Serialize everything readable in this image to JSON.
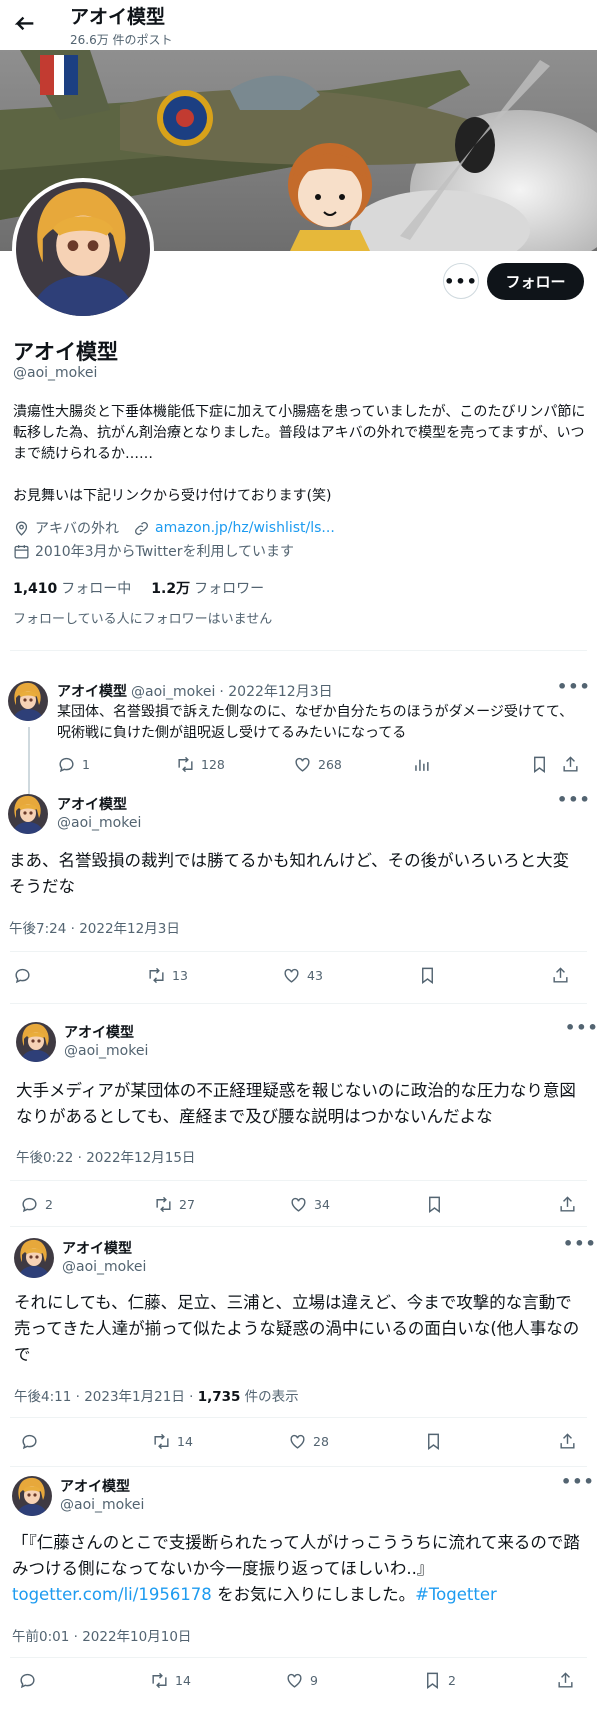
{
  "header": {
    "title": "アオイ模型",
    "post_count": "26.6万 件のポスト"
  },
  "profile": {
    "name": "アオイ模型",
    "handle": "@aoi_mokei",
    "follow_label": "フォロー",
    "more_label": "•••",
    "bio": [
      "潰瘍性大腸炎と下垂体機能低下症に加えて小腸癌を患っていましたが、このたびリンパ節に転移した為、抗がん剤治療となりました。普段はアキバの外れで模型を売ってますが、いつまで続けられるか……",
      "お見舞いは下記リンクから受け付けております(笑)"
    ],
    "location": "アキバの外れ",
    "url": "amazon.jp/hz/wishlist/ls...",
    "joined": "2010年3月からTwitterを利用しています",
    "following_count": "1,410",
    "following_label": "フォロー中",
    "followers_count": "1.2万",
    "followers_label": "フォロワー",
    "followers_note": "フォローしている人にフォロワーはいません"
  },
  "tweets": [
    {
      "name": "アオイ模型",
      "handle": "@aoi_mokei",
      "date_inline": "· 2022年12月3日",
      "text": "某団体、名誉毀損で訴えた側なのに、なぜか自分たちのほうがダメージ受けてて、呪術戦に負けた側が詛呪返し受けてるみたいになってる",
      "replies": "1",
      "retweets": "128",
      "likes": "268"
    },
    {
      "name": "アオイ模型",
      "handle": "@aoi_mokei",
      "text": "まあ、名誉毀損の裁判では勝てるかも知れんけど、その後がいろいろと大変そうだな",
      "date": "午後7:24 · 2022年12月3日",
      "replies": "",
      "retweets": "13",
      "likes": "43"
    },
    {
      "name": "アオイ模型",
      "handle": "@aoi_mokei",
      "text": "大手メディアが某団体の不正経理疑惑を報じないのに政治的な圧力なり意図なりがあるとしても、産経まで及び腰な説明はつかないんだよな",
      "date": "午後0:22 · 2022年12月15日",
      "replies": "2",
      "retweets": "27",
      "likes": "34"
    },
    {
      "name": "アオイ模型",
      "handle": "@aoi_mokei",
      "text": "それにしても、仁藤、足立、三浦と、立場は違えど、今まで攻撃的な言動で売ってきた人達が揃って似たような疑惑の渦中にいるの面白いな(他人事なので",
      "date": "午後4:11 · 2023年1月21日 · ",
      "views_count": "1,735",
      "views_label": " 件の表示",
      "replies": "",
      "retweets": "14",
      "likes": "28"
    },
    {
      "name": "アオイ模型",
      "handle": "@aoi_mokei",
      "text_a": "「『仁藤さんのとこで支援断られたって人がけっこううちに流れて来るので踏みつける側になってないか今一度振り返ってほしいわ..』",
      "link": "togetter.com/li/1956178",
      "text_b": "をお気に入りにしました。",
      "hashtag": "#Togetter",
      "date": "午前0:01 · 2022年10月10日",
      "replies": "",
      "retweets": "14",
      "likes": "9",
      "bookmarks": "2"
    }
  ],
  "colors": {
    "accent": "#1d9bf0",
    "text": "#0f1419",
    "muted": "#536471",
    "follow_bg": "#0f1419"
  }
}
